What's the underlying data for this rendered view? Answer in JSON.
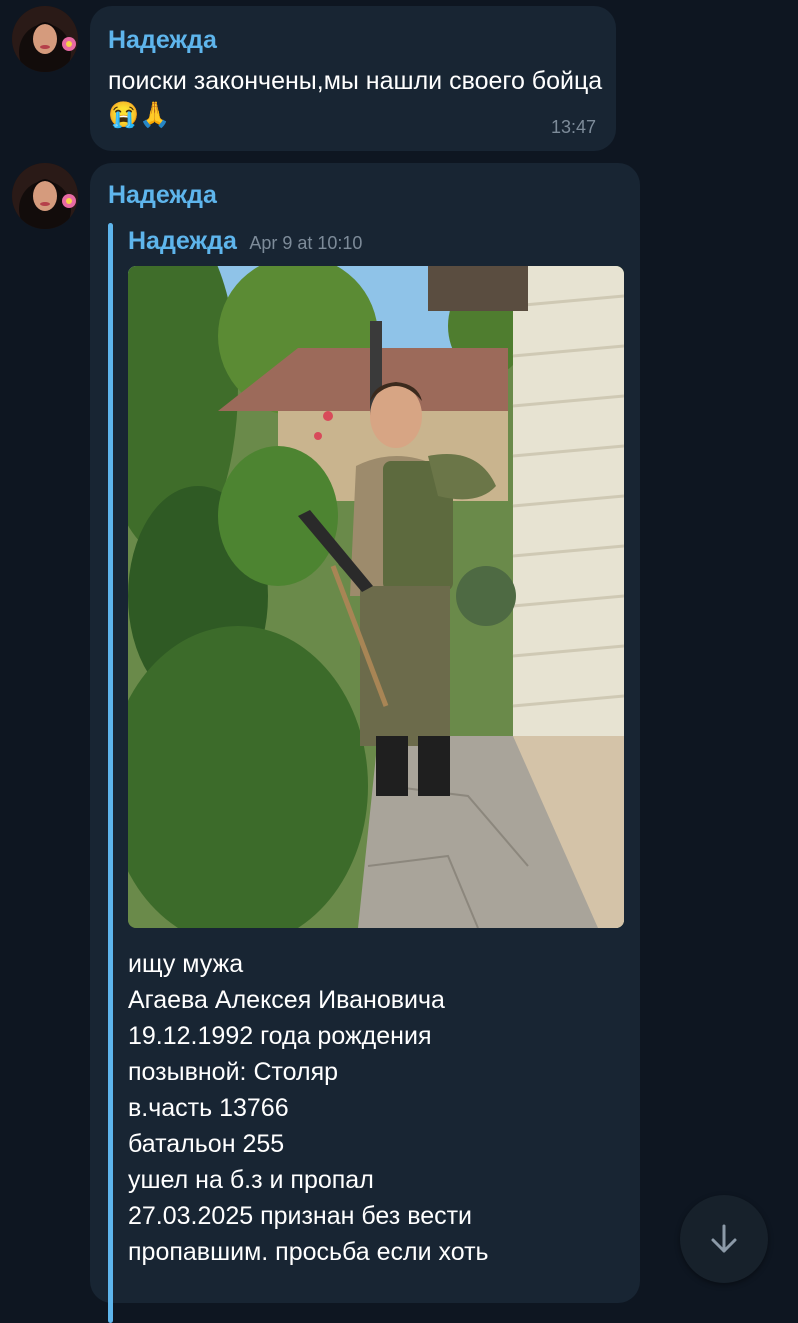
{
  "messages": [
    {
      "sender": "Надежда",
      "text": "поиски закончены,мы нашли своего бойца😭🙏",
      "time": "13:47"
    },
    {
      "sender": "Надежда",
      "forwarded": {
        "from": "Надежда",
        "date": "Apr 9 at 10:10",
        "lines": [
          "ищу мужа",
          "Агаева Алексея Ивановича",
          "19.12.1992 года рождения",
          "позывной: Столяр",
          "в.часть 13766",
          "батальон 255",
          "ушел на б.з и пропал",
          "27.03.2025 признан без вести",
          "пропавшим. просьба если хоть"
        ]
      }
    }
  ],
  "icons": {
    "scroll_down": "arrow-down-icon"
  },
  "colors": {
    "background": "#0e1621",
    "bubble": "#182533",
    "accent": "#5eb5ec",
    "text": "#ffffff",
    "meta": "#7d8b99"
  }
}
